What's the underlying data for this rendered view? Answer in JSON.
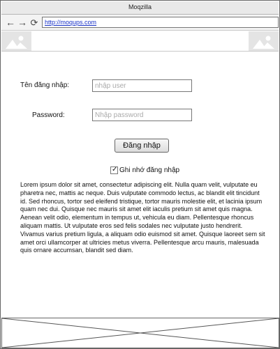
{
  "window": {
    "title": "Moqzilla"
  },
  "toolbar": {
    "back_icon": "arrow-left-icon",
    "forward_icon": "arrow-right-icon",
    "reload_icon": "reload-icon",
    "url": "http://moqups.com"
  },
  "header": {
    "left_image": "image-placeholder-icon",
    "right_image": "image-placeholder-icon"
  },
  "form": {
    "username_label": "Tên đăng nhập:",
    "username_placeholder": "nhập user",
    "username_value": "",
    "password_label": "Password:",
    "password_placeholder": "Nhập password",
    "password_value": "",
    "login_button": "Đăng nhập",
    "remember_label": "Ghi nhớ đăng nhập",
    "remember_checked": true
  },
  "content": {
    "paragraph": "Lorem ipsum dolor sit amet, consectetur adipiscing elit. Nulla quam velit, vulputate eu pharetra nec, mattis ac neque. Duis vulputate commodo lectus, ac blandit elit tincidunt id. Sed rhoncus, tortor sed eleifend tristique, tortor mauris molestie elit, et lacinia ipsum quam nec dui. Quisque nec mauris sit amet elit iaculis pretium sit amet quis magna. Aenean velit odio, elementum in tempus ut, vehicula eu diam. Pellentesque rhoncus aliquam mattis. Ut vulputate eros sed felis sodales nec vulputate justo hendrerit. Vivamus varius pretium ligula, a aliquam odio euismod sit amet. Quisque laoreet sem sit amet orci ullamcorper at ultricies metus viverra. Pellentesque arcu mauris, malesuada quis ornare accumsan, blandit sed diam."
  },
  "footer": {
    "placeholder": "image-placeholder"
  }
}
